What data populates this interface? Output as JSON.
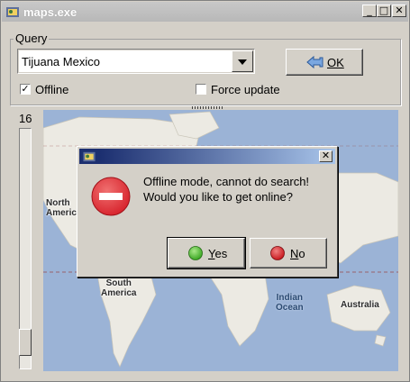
{
  "window": {
    "title": "maps.exe",
    "minimize_glyph": "_",
    "maximize_glyph": "□",
    "close_glyph": "✕"
  },
  "query": {
    "group_label": "Query",
    "location_value": "Tijuana Mexico",
    "ok_label": "OK",
    "offline_label": "Offline",
    "offline_checked": true,
    "offline_glyph": "✓",
    "force_update_label": "Force update",
    "force_update_checked": false
  },
  "zoom": {
    "level": "16"
  },
  "map": {
    "labels": {
      "north_america": "North\nAmerica",
      "south_america": "South\nAmerica",
      "indian_ocean": "Indian\nOcean",
      "australia": "Australia"
    },
    "colors": {
      "ocean": "#9bb3d6",
      "land": "#eceae3"
    }
  },
  "dialog": {
    "close_glyph": "✕",
    "message_line1": "Offline mode, cannot do search!",
    "message_line2": "Would you like to get online?",
    "yes_label": "Yes",
    "no_label": "No",
    "icons": {
      "stop": "stop-sign-icon",
      "yes": "green-circle-icon",
      "no": "red-circle-icon"
    },
    "colors": {
      "stop_red": "#d8262f",
      "yes_green": "#3aa622",
      "no_red": "#c8191e"
    }
  }
}
